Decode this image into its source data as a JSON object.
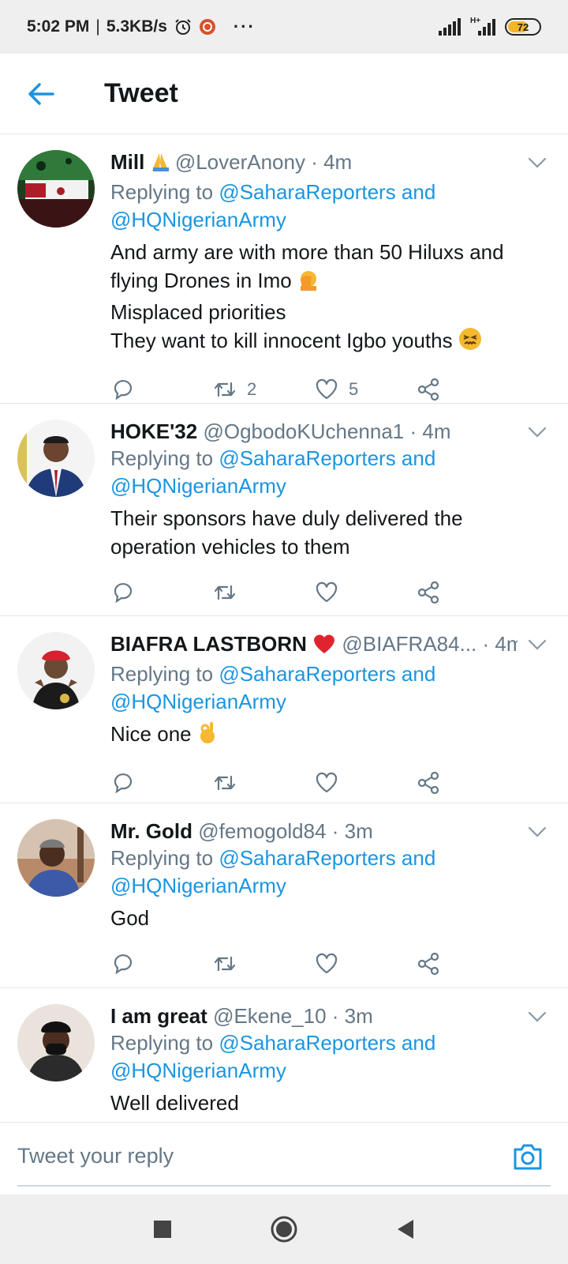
{
  "status_bar": {
    "time": "5:02 PM",
    "separator": "|",
    "speed": "5.3KB/s",
    "network": "H+",
    "battery": "72",
    "overflow_dots": "···"
  },
  "header": {
    "title": "Tweet"
  },
  "tweets": [
    {
      "name": "Mill",
      "handle": "@LoverAnony",
      "time": "· 4m",
      "replying_prefix": "Replying to",
      "replying_users": "@SaharaReporters and @HQNigerianArmy",
      "body": [
        "And army are with more than 50 Hiluxs and flying Drones in Imo",
        "Misplaced priorities",
        "They want to kill innocent Igbo youths"
      ],
      "retweets": "2",
      "likes": "5"
    },
    {
      "name": "HOKE'32",
      "handle": "@OgbodoKUchenna1",
      "time": "· 4m",
      "replying_prefix": "Replying to",
      "replying_users": "@SaharaReporters and @HQNigerianArmy",
      "body": [
        "Their sponsors have duly delivered the operation vehicles to them"
      ],
      "retweets": "",
      "likes": ""
    },
    {
      "name": "BIAFRA LASTBORN",
      "handle": "@BIAFRA84...",
      "time": "· 4m",
      "replying_prefix": "Replying to",
      "replying_users": "@SaharaReporters and @HQNigerianArmy",
      "body": [
        "Nice one"
      ],
      "retweets": "",
      "likes": ""
    },
    {
      "name": "Mr. Gold",
      "handle": "@femogold84",
      "time": "· 3m",
      "replying_prefix": "Replying to",
      "replying_users": "@SaharaReporters and @HQNigerianArmy",
      "body": [
        "God"
      ],
      "retweets": "",
      "likes": ""
    },
    {
      "name": "I am great",
      "handle": "@Ekene_10",
      "time": "· 3m",
      "replying_prefix": "Replying to",
      "replying_users": "@SaharaReporters and @HQNigerianArmy",
      "body": [
        "Well delivered"
      ],
      "retweets": "",
      "likes": ""
    }
  ],
  "composer": {
    "placeholder": "Tweet your reply"
  },
  "colors": {
    "accent": "#1b95e0",
    "secondary_text": "#657786",
    "divider": "#e1e8ed"
  }
}
